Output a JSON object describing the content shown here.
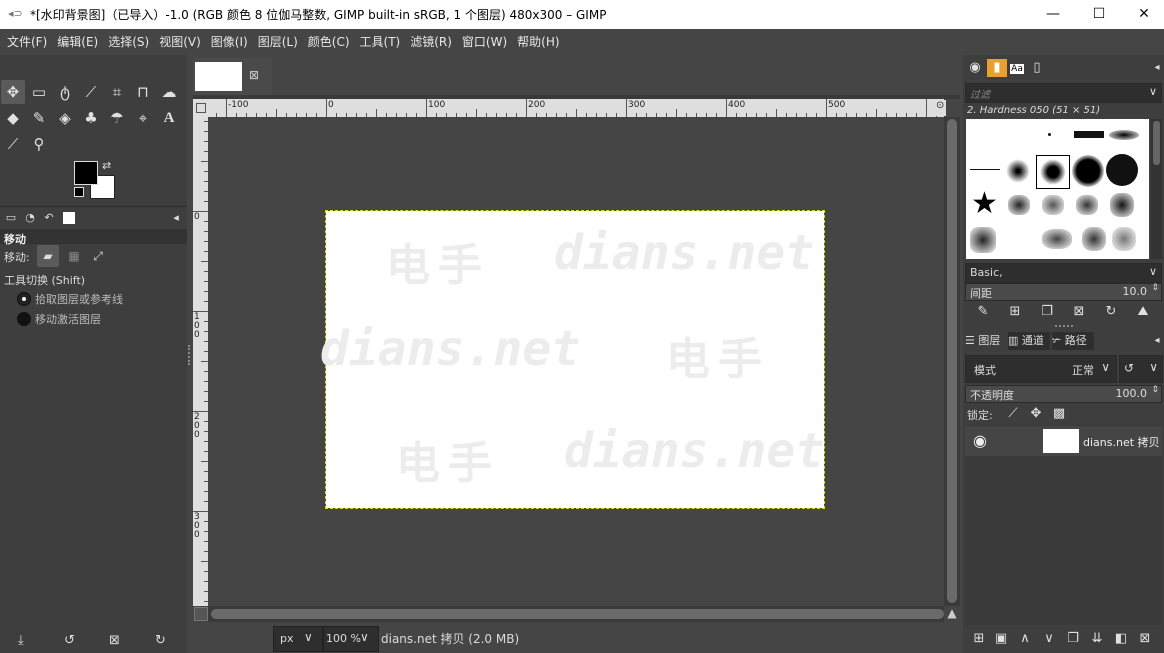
{
  "window": {
    "title": "*[水印背景图]（已导入）-1.0 (RGB 颜色 8 位伽马整数, GIMP built-in sRGB, 1 个图层) 480x300 – GIMP",
    "minimize": "—",
    "maximize": "☐",
    "close": "✕"
  },
  "menu": [
    "文件(F)",
    "编辑(E)",
    "选择(S)",
    "视图(V)",
    "图像(I)",
    "图层(L)",
    "颜色(C)",
    "工具(T)",
    "滤镜(R)",
    "窗口(W)",
    "帮助(H)"
  ],
  "tool_options": {
    "title": "移动",
    "move_label": "移动:",
    "toggle_label": "工具切换 (Shift)",
    "options": [
      {
        "label": "拾取图层或参考线",
        "selected": true
      },
      {
        "label": "移动激活图层",
        "selected": false
      }
    ]
  },
  "ruler": {
    "top_labels": [
      "-100",
      "0",
      "100",
      "200",
      "300",
      "400",
      "500"
    ],
    "left_labels": [
      "0",
      "100",
      "200",
      "300"
    ]
  },
  "canvas": {
    "watermark_cn": "电手",
    "watermark_en": "dians.net"
  },
  "status": {
    "unit": "px",
    "zoom": "100 %",
    "info": "dians.net 拷贝 (2.0 MB)"
  },
  "brushes": {
    "filter_placeholder": "过滤",
    "selected_brush": "2. Hardness 050 (51 × 51)",
    "preset": "Basic,",
    "spacing_label": "间距",
    "spacing_value": "10.0"
  },
  "layers": {
    "tabs": [
      "图层",
      "通道",
      "路径"
    ],
    "mode_label": "模式",
    "mode_value": "正常",
    "opacity_label": "不透明度",
    "opacity_value": "100.0",
    "lock_label": "锁定:",
    "items": [
      {
        "name": "dians.net 拷贝",
        "visible": true
      }
    ]
  }
}
